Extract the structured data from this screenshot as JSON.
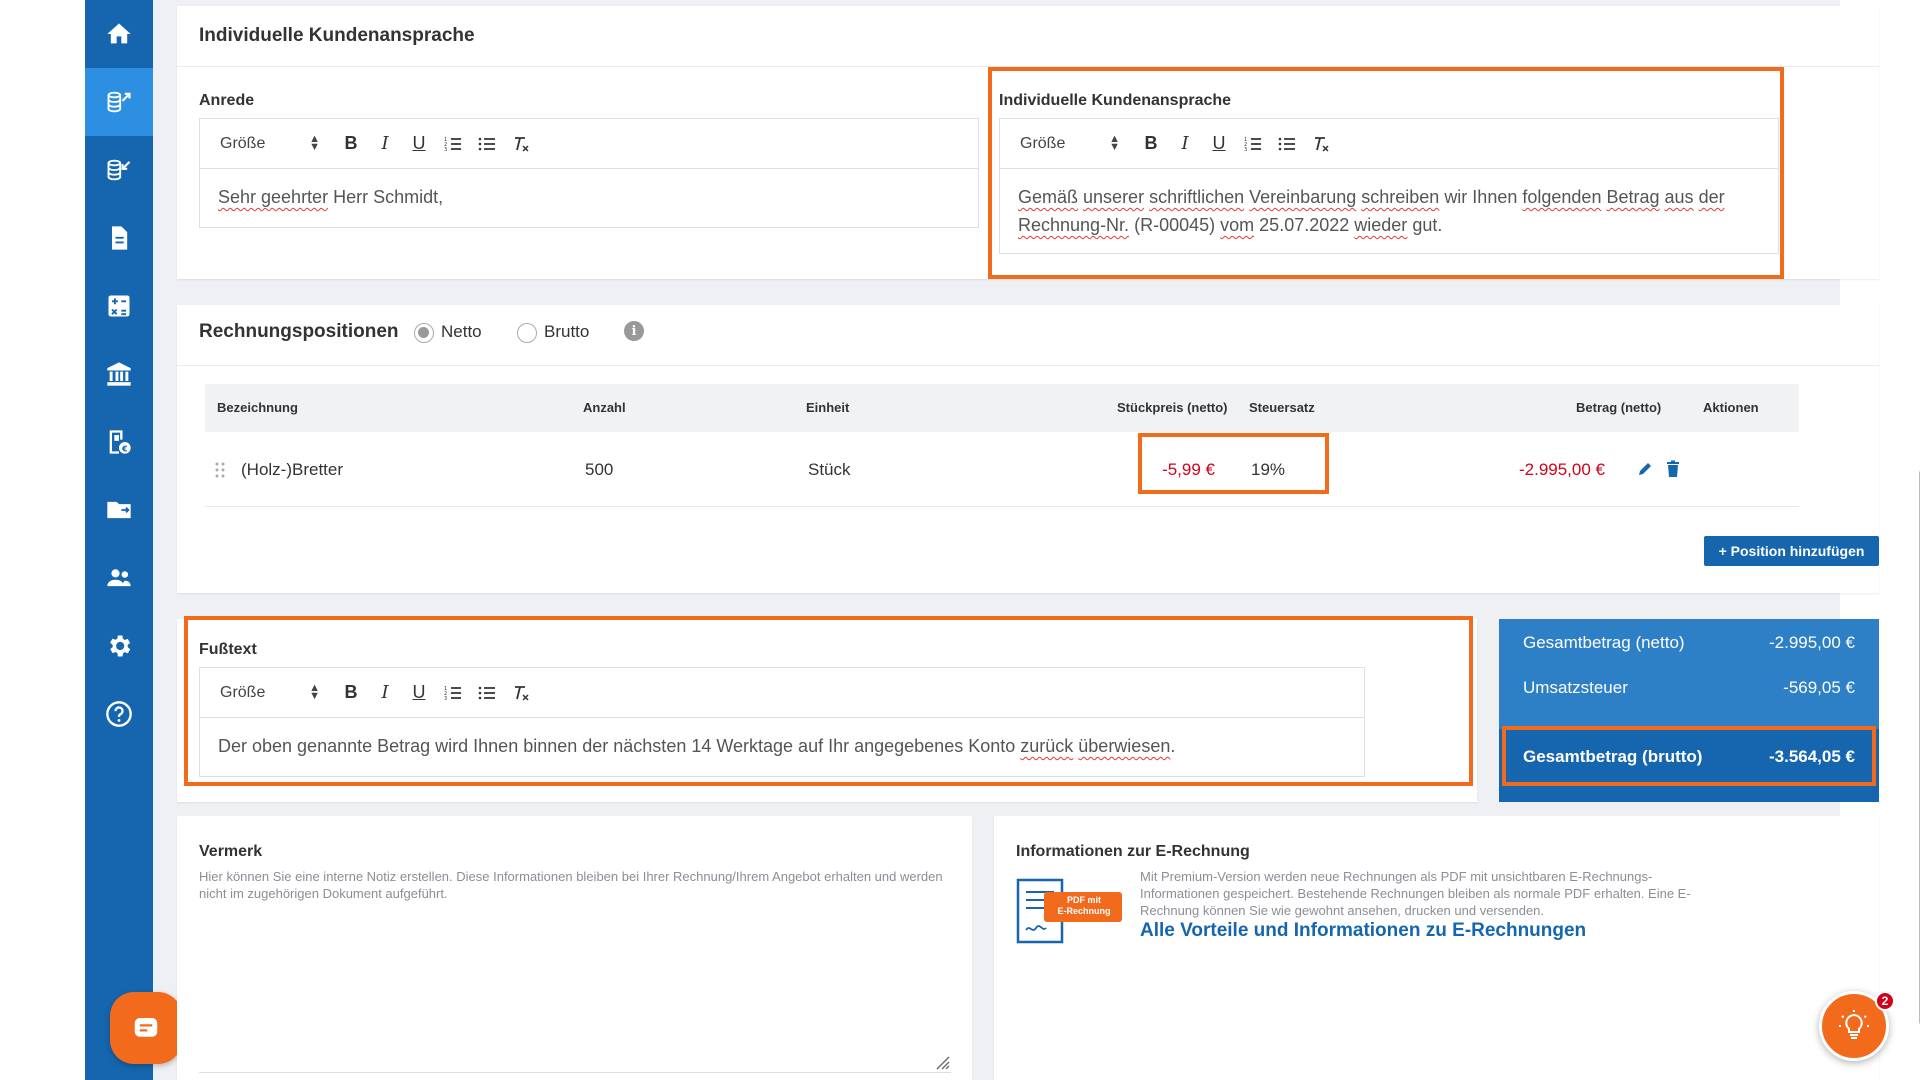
{
  "sidebar": {
    "items": [
      {
        "icon": "home-icon",
        "active": false
      },
      {
        "icon": "outgoing-invoices-icon",
        "active": true
      },
      {
        "icon": "incoming-invoices-icon",
        "active": false
      },
      {
        "icon": "document-icon",
        "active": false
      },
      {
        "icon": "calculator-icon",
        "active": false
      },
      {
        "icon": "bank-icon",
        "active": false
      },
      {
        "icon": "receipt-euro-icon",
        "active": false
      },
      {
        "icon": "folder-icon",
        "active": false
      },
      {
        "icon": "contacts-icon",
        "active": false
      },
      {
        "icon": "settings-icon",
        "active": false
      },
      {
        "icon": "help-icon",
        "active": false
      }
    ]
  },
  "greeting": {
    "title": "Individuelle Kundenansprache",
    "salutation_label": "Anrede",
    "salutation_text_a": "Sehr geehrter",
    "salutation_text_b": " Herr Schmidt,",
    "custom_label": "Individuelle Kundenansprache",
    "custom_text": {
      "w1": "Gemäß",
      "w2": "unserer",
      "w3": "schriftlichen",
      "w4": "Vereinbarung",
      "w5": "schreiben",
      "w6": "wir Ihnen",
      "w7": "folgenden",
      "w8": "Betrag",
      "w9": "aus",
      "w10": "der",
      "w11": "Rechnung-Nr.",
      "w12": "(R-00045)",
      "w13": "vom",
      "w14": "25.07.2022",
      "w15": "wieder",
      "w16": "gut."
    }
  },
  "toolbar": {
    "size_label": "Größe",
    "bold": "B",
    "italic": "I",
    "underline": "U"
  },
  "positions": {
    "title": "Rechnungspositionen",
    "radio_netto": "Netto",
    "radio_brutto": "Brutto",
    "selected": "Netto",
    "columns": [
      "Bezeichnung",
      "Anzahl",
      "Einheit",
      "Stückpreis (netto)",
      "Steuersatz",
      "Betrag (netto)",
      "Aktionen"
    ],
    "rows": [
      {
        "bezeichnung": "(Holz-)Bretter",
        "anzahl": "500",
        "einheit": "Stück",
        "stueckpreis": "-5,99 €",
        "steuersatz": "19%",
        "betrag": "-2.995,00 €"
      }
    ],
    "add_button": "+ Position hinzufügen"
  },
  "footer_text": {
    "label": "Fußtext",
    "text_a": "Der oben genannte Betrag wird Ihnen binnen der nächsten 14 Werktage auf Ihr angegebenes Konto ",
    "text_b": "zurück",
    "text_c": "überwiesen",
    "text_d": "."
  },
  "totals": {
    "net_label": "Gesamtbetrag (netto)",
    "net_value": "-2.995,00 €",
    "tax_label": "Umsatzsteuer",
    "tax_value": "-569,05 €",
    "gross_label": "Gesamtbetrag (brutto)",
    "gross_value": "-3.564,05 €"
  },
  "note": {
    "title": "Vermerk",
    "hint": "Hier können Sie eine interne Notiz erstellen. Diese Informationen bleiben bei Ihrer Rechnung/Ihrem Angebot erhalten und werden nicht im zugehörigen Dokument aufgeführt."
  },
  "einvoice": {
    "title": "Informationen zur E-Rechnung",
    "badge_line1": "PDF mit",
    "badge_line2": "E-Rechnung",
    "text": "Mit Premium-Version werden neue Rechnungen als PDF mit unsichtbaren E-Rechnungs-Informationen gespeichert. Bestehende Rechnungen bleiben als normale PDF erhalten. Eine E-Rechnung können Sie wie gewohnt ansehen, drucken und versenden.",
    "link": "Alle Vorteile und Informationen zu E-Rechnungen"
  },
  "notification_count": "2",
  "colors": {
    "brand_blue": "#1566ae",
    "accent_orange": "#f26b1d",
    "negative_red": "#d0021b"
  }
}
